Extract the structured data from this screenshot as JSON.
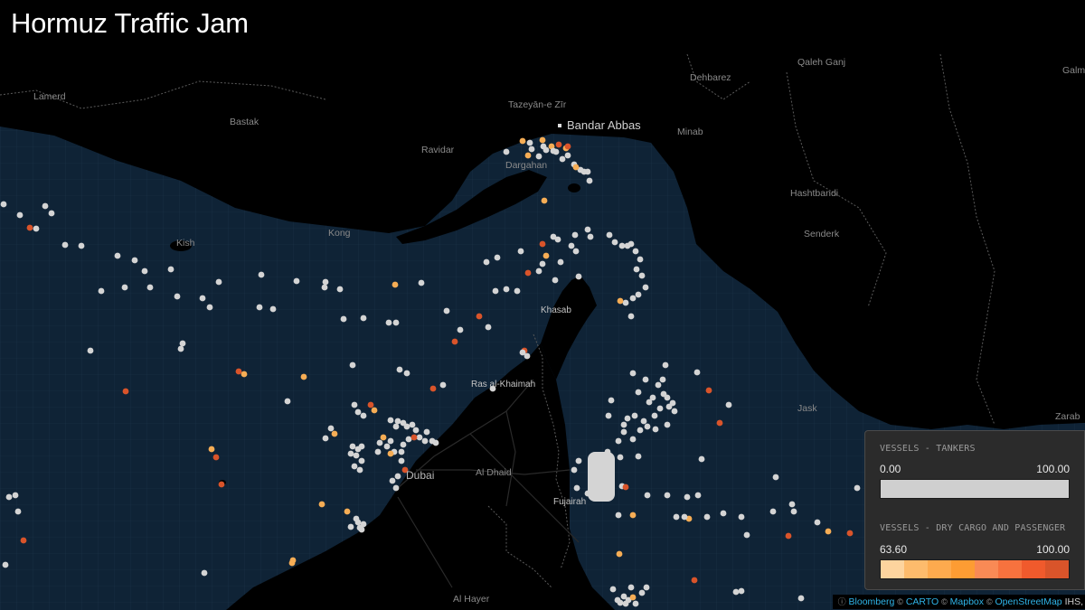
{
  "title": "Hormuz Traffic Jam",
  "places": {
    "lamerd": "Lamerd",
    "bastak": "Bastak",
    "tazeyan": "Tazeyān-e Zīr",
    "bandar_abbas": "Bandar Abbas",
    "dehbarez": "Dehbarez",
    "qaleh_ganj": "Qaleh Ganj",
    "galm": "Galm",
    "minab": "Minab",
    "ravidar": "Ravidar",
    "dargahan": "Dargahan",
    "hashtbandi": "Hashtbandi",
    "kish": "Kish",
    "kong": "Kong",
    "senderk": "Senderk",
    "khasab": "Khasab",
    "ras_al_khaimah": "Ras al-Khaimah",
    "jask": "Jask",
    "zarabad": "Zarab",
    "dubai": "Dubai",
    "al_dhaid": "Al Dhaid",
    "fujairah": "Fujairah",
    "al_hayer": "Al Hayer"
  },
  "legend": {
    "tankers_title": "VESSELS - TANKERS",
    "tankers_min": "0.00",
    "tankers_max": "100.00",
    "tankers_color": "#cfcfcf",
    "cargo_title": "VESSELS - DRY CARGO AND PASSENGER",
    "cargo_min": "63.60",
    "cargo_max": "100.00",
    "cargo_colors": [
      "#fdd49e",
      "#fdbb6c",
      "#fdaa4e",
      "#fd9c33",
      "#f98a55",
      "#f7723e",
      "#f05a2c",
      "#d9542a"
    ]
  },
  "attribution": {
    "bloomberg": "Bloomberg",
    "carto": "CARTO",
    "mapbox": "Mapbox",
    "osm": "OpenStreetMap",
    "ihs": "IHS,"
  },
  "colors": {
    "sea": "#0f2336",
    "land": "#000000",
    "tanker": "#d4d4d4",
    "cargo_light": "#f6ad55",
    "cargo_dark": "#d9542a"
  }
}
